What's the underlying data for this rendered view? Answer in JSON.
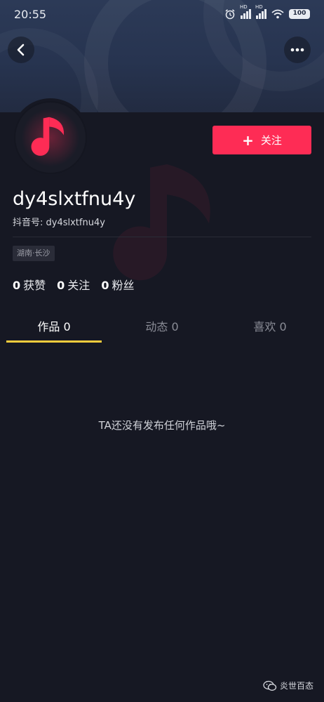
{
  "status_bar": {
    "time": "20:55",
    "battery": "100",
    "hd1": "HD",
    "hd2": "HD"
  },
  "profile": {
    "username": "dy4slxtfnu4y",
    "douyin_id": "抖音号: dy4slxtfnu4y",
    "location_tag": "湖南·长沙",
    "follow_label": "关注",
    "follow_plus": "+"
  },
  "stats": [
    {
      "count": "0",
      "label": "获赞"
    },
    {
      "count": "0",
      "label": "关注"
    },
    {
      "count": "0",
      "label": "粉丝"
    }
  ],
  "tabs": [
    {
      "label": "作品 0",
      "active": true
    },
    {
      "label": "动态 0",
      "active": false
    },
    {
      "label": "喜欢 0",
      "active": false
    }
  ],
  "empty_message": "TA还没有发布任何作品哦~",
  "watermark": "炎世百态",
  "colors": {
    "accent": "#fe2c55",
    "tab_indicator": "#facd3d",
    "background": "#161823"
  },
  "icons": {
    "back": "chevron-left-icon",
    "more": "more-dots-icon",
    "avatar": "music-note-icon"
  }
}
